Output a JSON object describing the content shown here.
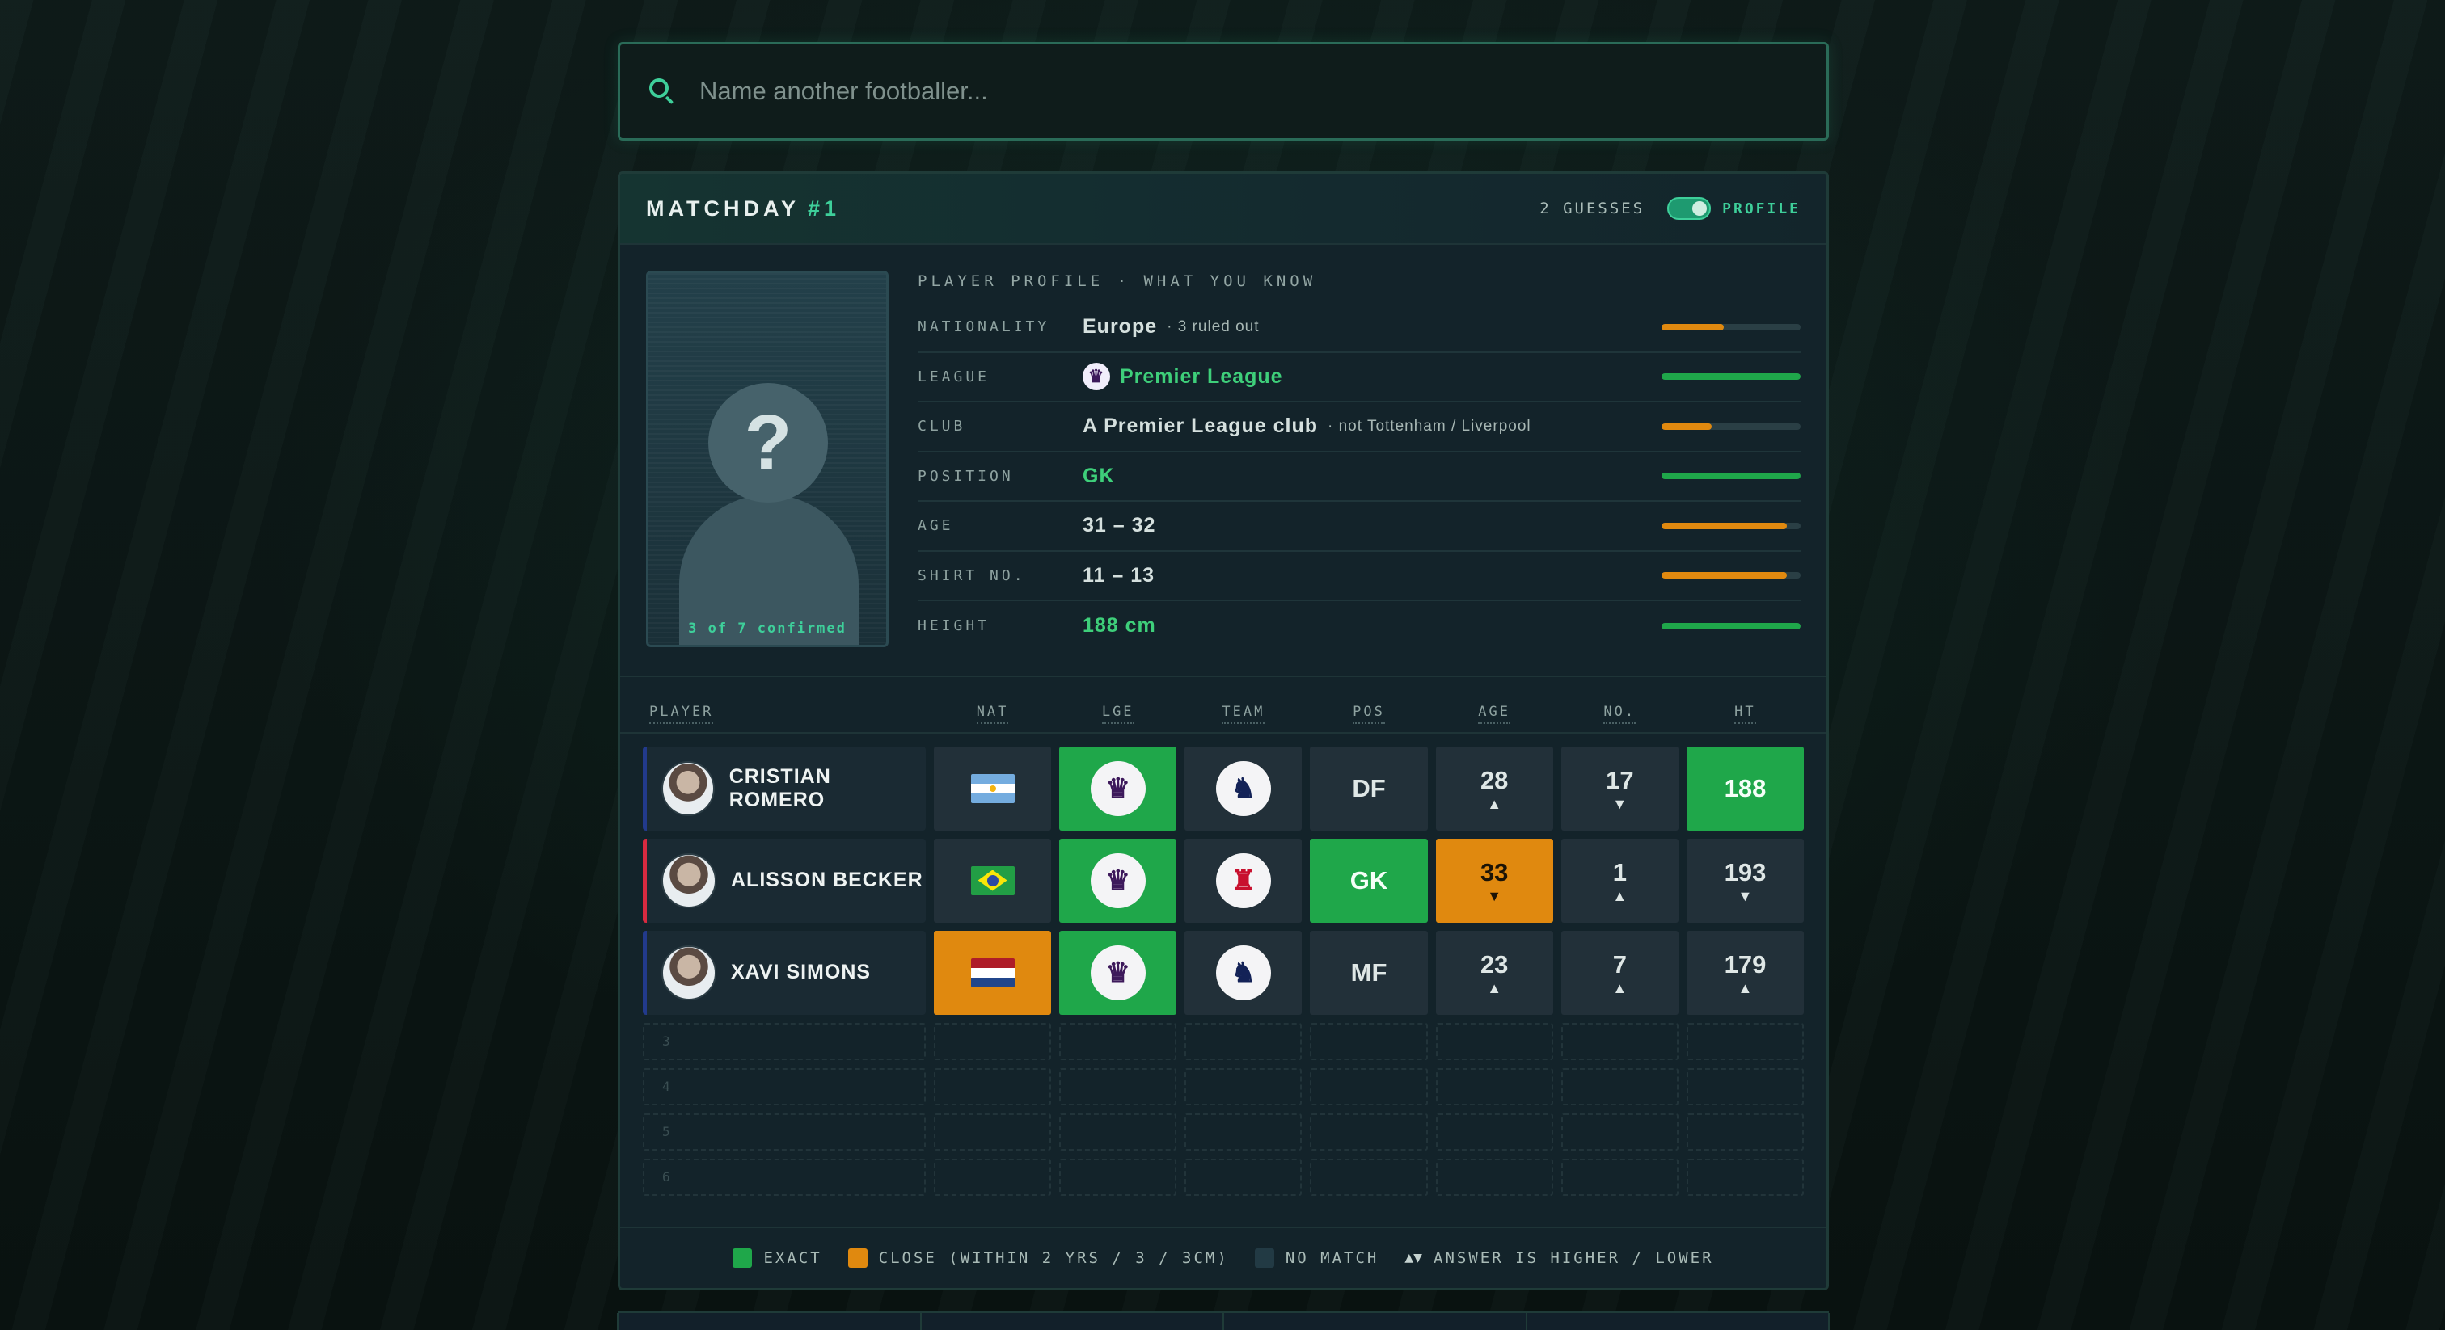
{
  "search": {
    "placeholder": "Name another footballer..."
  },
  "header": {
    "title": "MATCHDAY",
    "number": "#1",
    "guesses": "2 GUESSES",
    "toggle_label": "PROFILE",
    "toggle_on": true
  },
  "profile": {
    "title": "PLAYER PROFILE · WHAT YOU KNOW",
    "confirmed": "3 of 7 confirmed",
    "mystery_glyph": "?",
    "rows": [
      {
        "label": "NATIONALITY",
        "value": "Europe",
        "note": "· 3 ruled out",
        "status": "close",
        "progress": 0.45
      },
      {
        "label": "LEAGUE",
        "value": "Premier League",
        "note": "",
        "status": "exact",
        "progress": 1.0,
        "icon": "premier-league-icon"
      },
      {
        "label": "CLUB",
        "value": "A Premier League club",
        "note": "· not Tottenham / Liverpool",
        "status": "close",
        "progress": 0.36
      },
      {
        "label": "POSITION",
        "value": "GK",
        "note": "",
        "status": "exact",
        "progress": 1.0
      },
      {
        "label": "AGE",
        "value": "31 – 32",
        "note": "",
        "status": "close",
        "progress": 0.9
      },
      {
        "label": "SHIRT NO.",
        "value": "11 – 13",
        "note": "",
        "status": "close",
        "progress": 0.9
      },
      {
        "label": "HEIGHT",
        "value": "188 cm",
        "note": "",
        "status": "exact",
        "progress": 1.0
      }
    ]
  },
  "columns": [
    "PLAYER",
    "NAT",
    "LGE",
    "TEAM",
    "POS",
    "AGE",
    "NO.",
    "HT"
  ],
  "guesses": [
    {
      "name": "CRISTIAN ROMERO",
      "accent": "#223a8c",
      "nat": {
        "flag": "argentina-flag",
        "status": "none"
      },
      "lge": {
        "icon": "premier-league-icon",
        "status": "exact"
      },
      "team": {
        "icon": "tottenham-crest-icon",
        "status": "none"
      },
      "pos": {
        "value": "DF",
        "status": "none"
      },
      "age": {
        "value": "28",
        "arrow": "▲",
        "status": "none"
      },
      "no": {
        "value": "17",
        "arrow": "▼",
        "status": "none"
      },
      "ht": {
        "value": "188",
        "arrow": "",
        "status": "exact"
      }
    },
    {
      "name": "ALISSON BECKER",
      "accent": "#d92a40",
      "nat": {
        "flag": "brazil-flag",
        "status": "none"
      },
      "lge": {
        "icon": "premier-league-icon",
        "status": "exact"
      },
      "team": {
        "icon": "liverpool-crest-icon",
        "status": "none"
      },
      "pos": {
        "value": "GK",
        "status": "exact"
      },
      "age": {
        "value": "33",
        "arrow": "▼",
        "status": "close"
      },
      "no": {
        "value": "1",
        "arrow": "▲",
        "status": "none"
      },
      "ht": {
        "value": "193",
        "arrow": "▼",
        "status": "none"
      }
    },
    {
      "name": "XAVI SIMONS",
      "accent": "#223a8c",
      "nat": {
        "flag": "netherlands-flag",
        "status": "close"
      },
      "lge": {
        "icon": "premier-league-icon",
        "status": "exact"
      },
      "team": {
        "icon": "tottenham-crest-icon",
        "status": "none"
      },
      "pos": {
        "value": "MF",
        "status": "none"
      },
      "age": {
        "value": "23",
        "arrow": "▲",
        "status": "none"
      },
      "no": {
        "value": "7",
        "arrow": "▲",
        "status": "none"
      },
      "ht": {
        "value": "179",
        "arrow": "▲",
        "status": "none"
      }
    }
  ],
  "empty_rows": [
    "3",
    "4",
    "5",
    "6"
  ],
  "legend": {
    "exact": "EXACT",
    "close": "CLOSE (WITHIN 2 YRS / 3 / 3CM)",
    "none": "NO MATCH",
    "arrows_glyph": "▲▼",
    "arrows": "ANSWER IS HIGHER / LOWER"
  },
  "colors": {
    "exact": "#1fa74a",
    "close": "#e0890f",
    "none": "#223039",
    "accent": "#3ecf9a"
  }
}
